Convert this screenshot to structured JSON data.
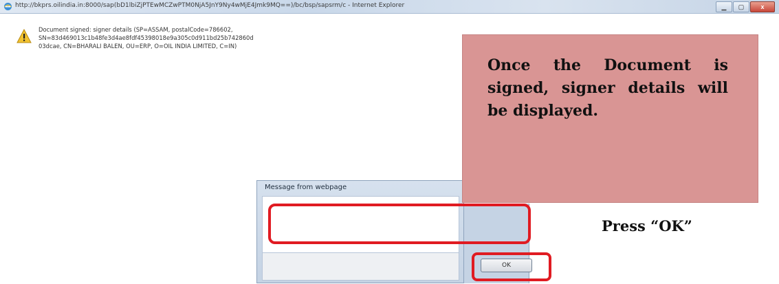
{
  "window": {
    "title": "http://bkprs.oilindia.in:8000/sap(bD1lbiZjPTEwMCZwPTM0NjA5JnY9Ny4wMjE4Jmk9MQ==)/bc/bsp/sapsrm/c - Internet Explorer",
    "minimize_icon": "minimize-icon",
    "maximize_icon": "maximize-icon",
    "close_label": "x"
  },
  "callout": {
    "text": "Once the Document is signed, signer details will be displayed."
  },
  "dialog": {
    "title": "Message from webpage",
    "message": "Document signed: signer details (SP=ASSAM, postalCode=786602,\nSN=83d469013c1b48fe3d4ae8fdf45398018e9a305c0d911bd25b742860d\n03dcae, CN=BHARALI BALEN, OU=ERP, O=OIL INDIA LIMITED, C=IN)",
    "ok_label": "OK",
    "icon": "warning-icon"
  },
  "annotation": {
    "press_ok": "Press “OK”"
  },
  "colors": {
    "callout_bg": "#d99594",
    "highlight_red": "#e01b22"
  }
}
